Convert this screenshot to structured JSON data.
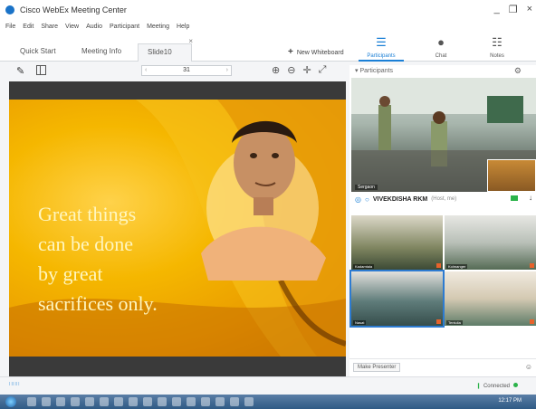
{
  "window": {
    "title": "Cisco WebEx Meeting Center",
    "controls": [
      "_",
      " Ι",
      "×"
    ]
  },
  "menu": [
    "File",
    "Edit",
    "Share",
    "View",
    "Audio",
    "Participant",
    "Meeting",
    "Help"
  ],
  "tabs": {
    "quick_start": "Quick Start",
    "meeting_info": "Meeting Info",
    "slide": "Slide10",
    "close": "×",
    "new_whiteboard": "New Whiteboard"
  },
  "right_tabs": {
    "participants": "Participants",
    "chat": "Chat",
    "notes": "Notes"
  },
  "toolbar": {
    "page": "31"
  },
  "slide": {
    "lines": [
      "Great things",
      "can be done",
      "by great",
      "sacrifices only."
    ]
  },
  "participants_panel": {
    "header": "▾ Participants",
    "main_video_label": "Sergaon",
    "active_speaker": "VIVEKDISHA RKM",
    "active_speaker_sub": "(Host, me)",
    "tiles": [
      {
        "label": "Kadamtala"
      },
      {
        "label": "Kolmanger"
      },
      {
        "label": "Nasat"
      },
      {
        "label": "Tentulia"
      }
    ],
    "make_presenter": "Make Presenter"
  },
  "status": {
    "connected": "Connected",
    "clock": "12:17 PM"
  },
  "colors": {
    "accent": "#1a7fd6",
    "connected": "#2bb34a"
  }
}
